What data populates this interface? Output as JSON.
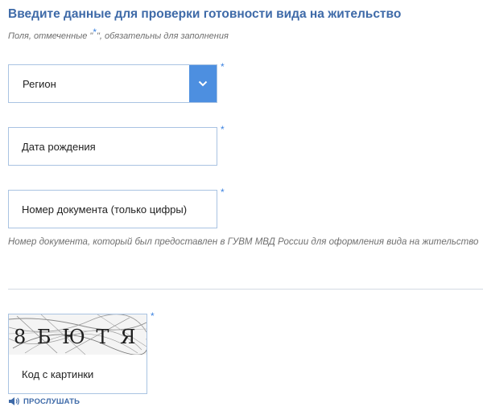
{
  "form": {
    "title": "Введите данные для проверки готовности вида на жительство",
    "required_note_before": "Поля, отмеченные \"",
    "required_star": "*",
    "required_note_after": "\", обязательны для заполнения"
  },
  "fields": {
    "region": {
      "label": "Регион",
      "required_mark": "*"
    },
    "birth_date": {
      "label": "Дата рождения",
      "required_mark": "*"
    },
    "doc_number": {
      "label": "Номер документа (только цифры)",
      "required_mark": "*"
    }
  },
  "doc_hint": "Номер документа, который был предоставлен в ГУВМ МВД России для оформления вида на жительство",
  "captcha": {
    "image_text": "8 Б Ю Т Я",
    "input_label": "Код с картинки",
    "required_mark": "*",
    "listen_label": "ПРОСЛУШАТЬ"
  },
  "colors": {
    "accent": "#3e6aa8",
    "required_star": "#3b82e0",
    "select_arrow_bg": "#4d8fe0",
    "field_border": "#a9c3e2"
  },
  "icons": {
    "select_arrow": "chevron-down-icon",
    "listen": "speaker-icon"
  }
}
